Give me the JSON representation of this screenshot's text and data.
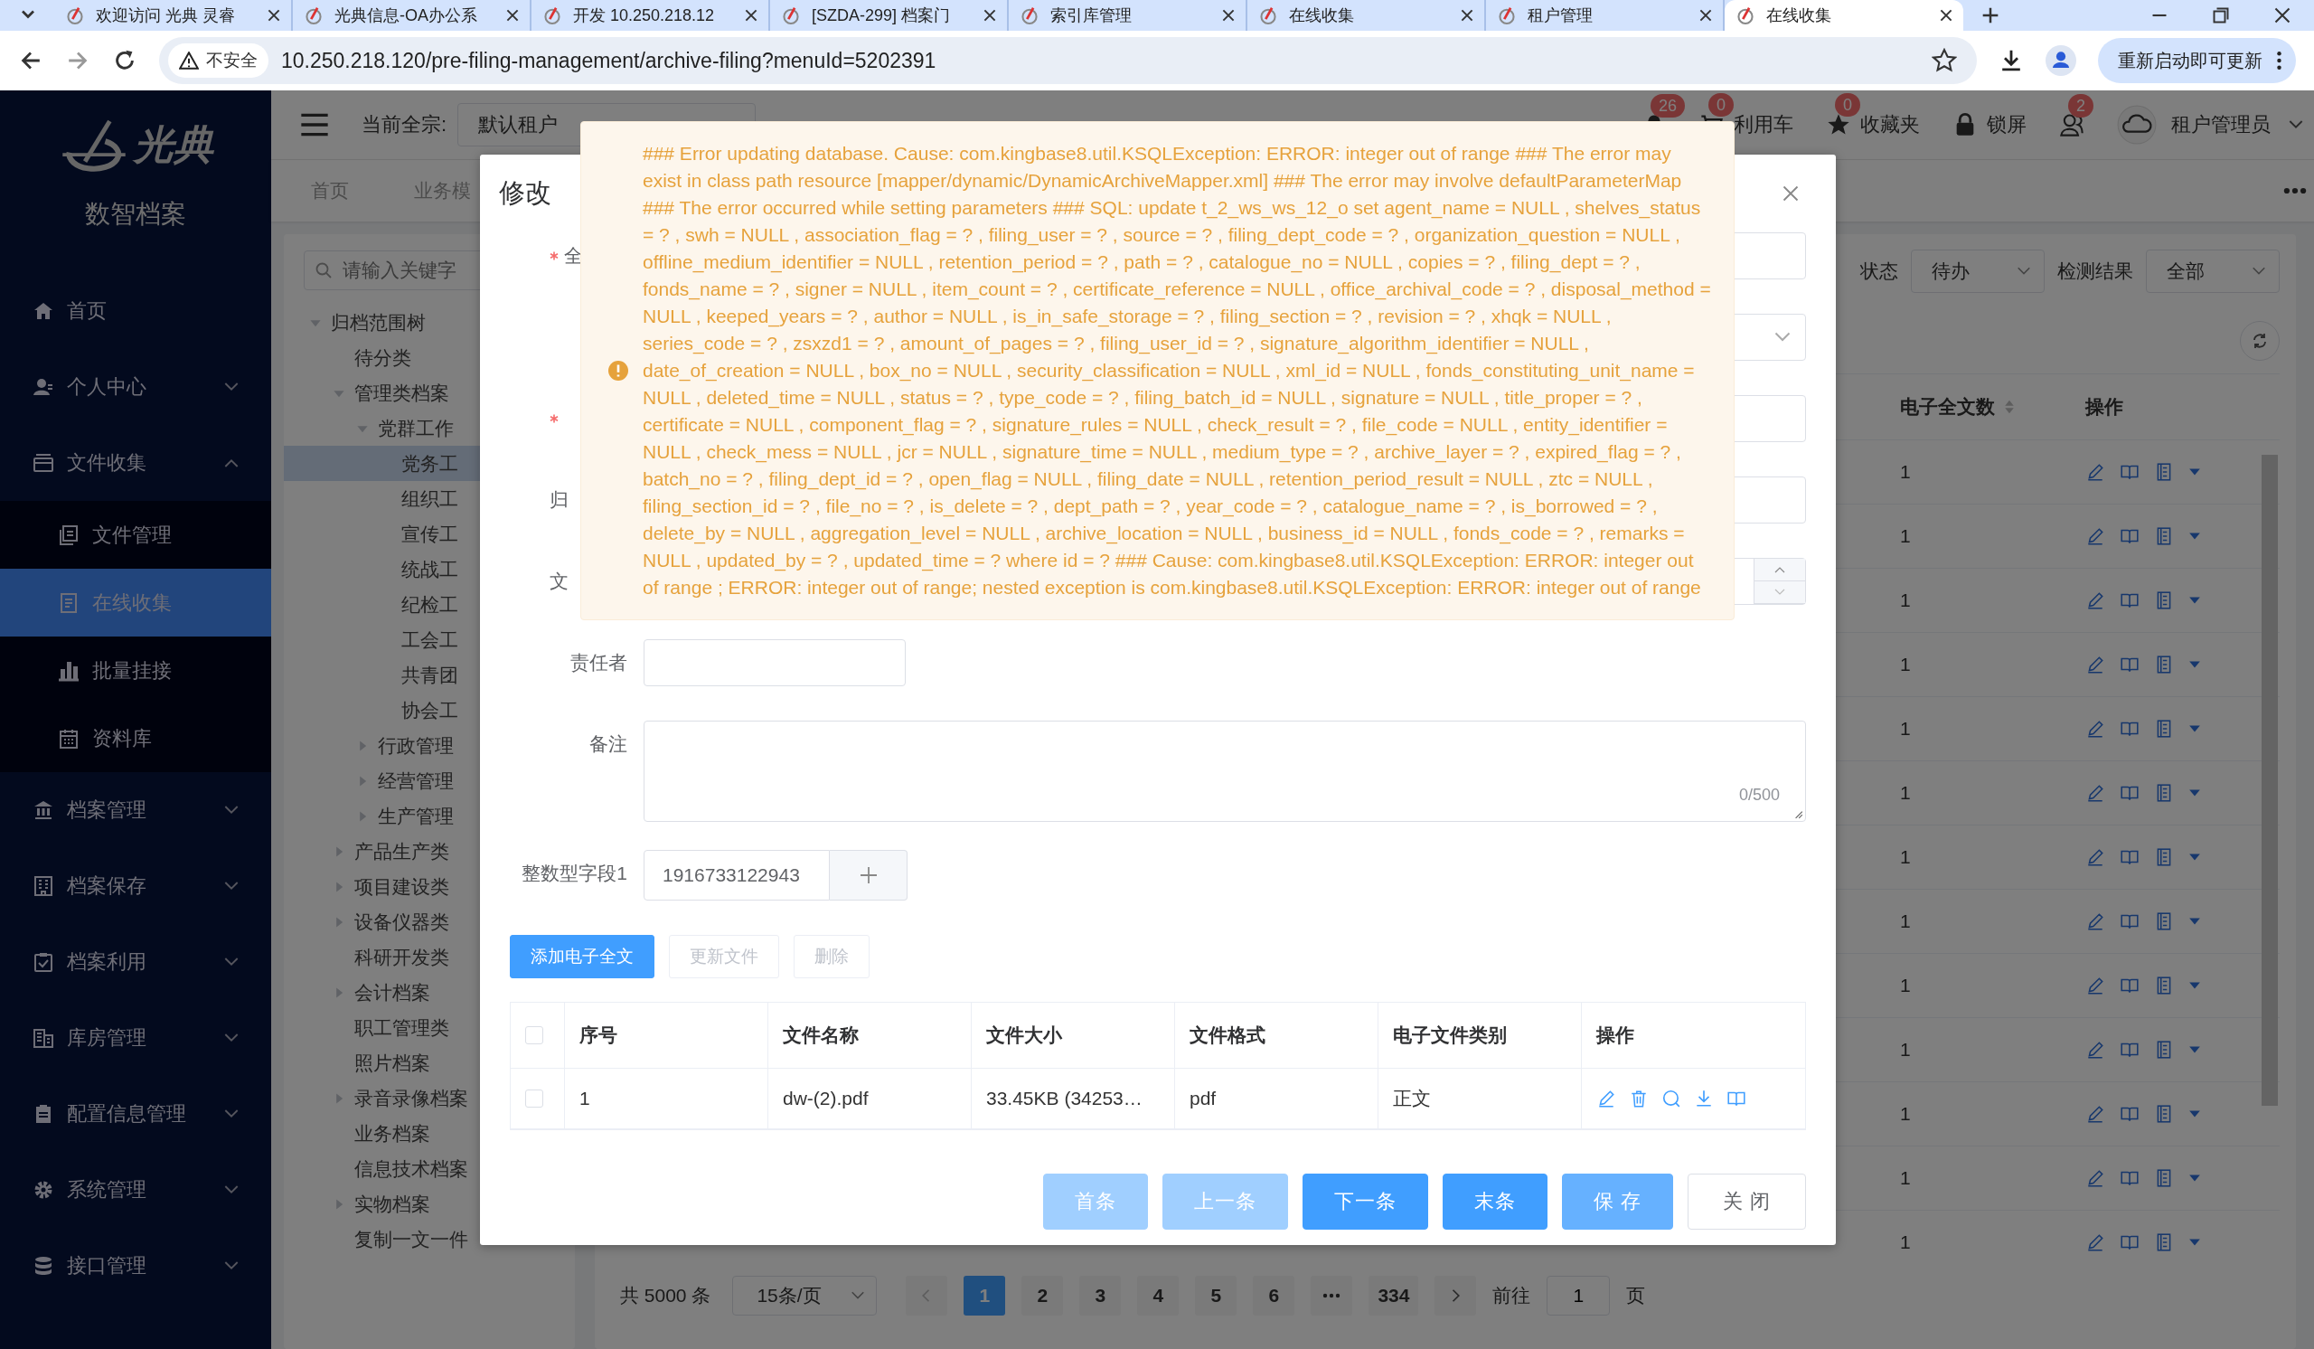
{
  "browser": {
    "tabs": [
      {
        "title": "欢迎访问 光典 灵睿",
        "selected": false
      },
      {
        "title": "光典信息-OA办公系",
        "selected": false
      },
      {
        "title": "开发 10.250.218.12",
        "selected": false
      },
      {
        "title": "[SZDA-299] 档案门",
        "selected": false
      },
      {
        "title": "索引库管理",
        "selected": false
      },
      {
        "title": "在线收集",
        "selected": false
      },
      {
        "title": "租户管理",
        "selected": false
      },
      {
        "title": "在线收集",
        "selected": true
      }
    ],
    "security_label": "不安全",
    "url": "10.250.218.120/pre-filing-management/archive-filing?menuId=5202391",
    "update_button": "重新启动即可更新"
  },
  "sidebar": {
    "brand": "光典",
    "subtitle": "数智档案",
    "menu": [
      {
        "label": "首页",
        "kind": "link"
      },
      {
        "label": "个人中心",
        "kind": "group",
        "expanded": false
      },
      {
        "label": "文件收集",
        "kind": "group",
        "expanded": true,
        "children": [
          {
            "label": "文件管理",
            "selected": false
          },
          {
            "label": "在线收集",
            "selected": true
          },
          {
            "label": "批量挂接",
            "selected": false
          },
          {
            "label": "资料库",
            "selected": false
          }
        ]
      },
      {
        "label": "档案管理",
        "kind": "group",
        "expanded": false
      },
      {
        "label": "档案保存",
        "kind": "group",
        "expanded": false
      },
      {
        "label": "档案利用",
        "kind": "group",
        "expanded": false
      },
      {
        "label": "库房管理",
        "kind": "group",
        "expanded": false
      },
      {
        "label": "配置信息管理",
        "kind": "group",
        "expanded": false
      },
      {
        "label": "系统管理",
        "kind": "group",
        "expanded": false
      },
      {
        "label": "接口管理",
        "kind": "group",
        "expanded": false
      }
    ]
  },
  "header": {
    "fonds_label": "当前全宗:",
    "fonds_value": "默认租户",
    "items": [
      {
        "badge": "26"
      },
      {
        "badge": "0",
        "label": "利用车"
      },
      {
        "badge": "0",
        "label": "收藏夹"
      },
      {
        "label": "锁屏"
      },
      {
        "badge": "2"
      }
    ],
    "user": "租户管理员"
  },
  "tags": [
    {
      "label": "首页",
      "selected": false
    },
    {
      "label": "业务模",
      "selected": false
    }
  ],
  "tree": {
    "search_placeholder": "请输入关键字",
    "nodes": [
      {
        "label": "归档范围树",
        "selected": false,
        "expanded": true,
        "children": [
          {
            "label": "待分类",
            "selected": false
          },
          {
            "label": "管理类档案",
            "selected": false,
            "expanded": true,
            "children": [
              {
                "label": "党群工作",
                "selected": false,
                "expanded": true,
                "children": [
                  {
                    "label": "党务工",
                    "selected": true
                  },
                  {
                    "label": "组织工",
                    "selected": false
                  },
                  {
                    "label": "宣传工",
                    "selected": false
                  },
                  {
                    "label": "统战工",
                    "selected": false
                  },
                  {
                    "label": "纪检工",
                    "selected": false
                  },
                  {
                    "label": "工会工",
                    "selected": false
                  },
                  {
                    "label": "共青团",
                    "selected": false
                  },
                  {
                    "label": "协会工",
                    "selected": false
                  }
                ]
              },
              {
                "label": "行政管理",
                "selected": false,
                "expanded": false
              },
              {
                "label": "经营管理",
                "selected": false,
                "expanded": false
              },
              {
                "label": "生产管理",
                "selected": false,
                "expanded": false
              }
            ]
          },
          {
            "label": "产品生产类",
            "selected": false,
            "expanded": false
          },
          {
            "label": "项目建设类",
            "selected": false,
            "expanded": false
          },
          {
            "label": "设备仪器类",
            "selected": false,
            "expanded": false
          },
          {
            "label": "科研开发类",
            "selected": false
          },
          {
            "label": "会计档案",
            "selected": false,
            "expanded": false
          },
          {
            "label": "职工管理类",
            "selected": false
          },
          {
            "label": "照片档案",
            "selected": false
          },
          {
            "label": "录音录像档案",
            "selected": false,
            "expanded": false
          },
          {
            "label": "业务档案",
            "selected": false
          },
          {
            "label": "信息技术档案",
            "selected": false
          },
          {
            "label": "实物档案",
            "selected": false,
            "expanded": false
          },
          {
            "label": "复制一文一件",
            "selected": false
          }
        ]
      }
    ]
  },
  "filters": [
    {
      "label": "状态",
      "value": "待办"
    },
    {
      "label": "检测结果",
      "value": "全部"
    }
  ],
  "table": {
    "columns": [
      "电子全文数",
      "操作"
    ],
    "rows": [
      {
        "count": "1"
      },
      {
        "count": "1"
      },
      {
        "count": "1"
      },
      {
        "count": "1"
      },
      {
        "count": "1"
      },
      {
        "count": "1"
      },
      {
        "count": "1"
      },
      {
        "count": "1"
      },
      {
        "count": "1"
      },
      {
        "count": "1"
      },
      {
        "count": "1"
      },
      {
        "count": "1"
      },
      {
        "count": "1"
      }
    ]
  },
  "pagination": {
    "total": "共 5000 条",
    "page_size": "15条/页",
    "pages": [
      {
        "label": "1",
        "selected": true
      },
      {
        "label": "2",
        "selected": false
      },
      {
        "label": "3",
        "selected": false
      },
      {
        "label": "4",
        "selected": false
      },
      {
        "label": "5",
        "selected": false
      },
      {
        "label": "6",
        "selected": false
      },
      {
        "kind": "ellipsis"
      },
      {
        "label": "334",
        "selected": false
      }
    ],
    "goto_label": "前往",
    "goto_value": "1",
    "page_unit": "页"
  },
  "modal": {
    "title": "修改",
    "covered_fields": [
      {
        "label": "全",
        "required": true,
        "kind": "input"
      },
      {
        "required": false,
        "kind": "select"
      },
      {
        "required": true,
        "kind": "input"
      },
      {
        "label": "归",
        "required": false,
        "kind": "input"
      },
      {
        "label": "文",
        "required": false,
        "kind": "number"
      }
    ],
    "responsible_label": "责任者",
    "remarks_label": "备注",
    "remarks_counter": "0/500",
    "int_label": "整数型字段1",
    "int_value": "1916733122943",
    "file_buttons": [
      {
        "label": "添加电子全文",
        "disabled": false
      },
      {
        "label": "更新文件",
        "disabled": true
      },
      {
        "label": "删除",
        "disabled": true
      }
    ],
    "file_table": {
      "all_checked": false,
      "columns": [
        "序号",
        "文件名称",
        "文件大小",
        "文件格式",
        "电子文件类别",
        "操作"
      ],
      "rows": [
        {
          "checked": false,
          "cells": [
            "1",
            "dw-(2).pdf",
            "33.45KB (34253…",
            "pdf",
            "正文"
          ]
        }
      ]
    },
    "footer_buttons": [
      {
        "label": "首条",
        "kind": "primary",
        "disabled": true,
        "hover": false
      },
      {
        "label": "上一条",
        "kind": "primary",
        "disabled": true,
        "hover": false
      },
      {
        "label": "下一条",
        "kind": "primary",
        "disabled": false,
        "hover": false
      },
      {
        "label": "末条",
        "kind": "primary",
        "disabled": false,
        "hover": false
      },
      {
        "label": "保 存",
        "kind": "primary",
        "disabled": false,
        "hover": true
      },
      {
        "label": "关 闭",
        "kind": "default",
        "disabled": false,
        "hover": false
      }
    ]
  },
  "toast": {
    "message": "### Error updating database. Cause: com.kingbase8.util.KSQLException: ERROR: integer out of range ### The error may exist in class path resource [mapper/dynamic/DynamicArchiveMapper.xml] ### The error may involve defaultParameterMap ### The error occurred while setting parameters ### SQL: update t_2_ws_ws_12_o set agent_name = NULL , shelves_status = ? , swh = NULL , association_flag = ? , filing_user = ? , source = ? , filing_dept_code = ? , organization_question = NULL , offline_medium_identifier = NULL , retention_period = ? , path = ? , catalogue_no = NULL , copies = ? , filing_dept = ? , fonds_name = ? , signer = NULL , item_count = ? , certificate_reference = NULL , office_archival_code = ? , disposal_method = NULL , keeped_years = ? , author = NULL , is_in_safe_storage = ? , filing_section = ? , revision = ? , xhqk = NULL , series_code = ? , zsxzd1 = ? , amount_of_pages = ? , filing_user_id = ? , signature_algorithm_identifier = NULL , date_of_creation = NULL , box_no = NULL , security_classification = NULL , xml_id = NULL , fonds_constituting_unit_name = NULL , deleted_time = NULL , status = ? , type_code = ? , filing_batch_id = NULL , signature = NULL , title_proper = ? , certificate = NULL , component_flag = ? , signature_rules = NULL , check_result = ? , file_code = NULL , entity_identifier = NULL , check_mess = NULL , jcr = NULL , signature_time = NULL , medium_type = ? , archive_layer = ? , expired_flag = ? , batch_no = ? , filing_dept_id = ? , open_flag = NULL , filing_date = NULL , retention_period_result = NULL , ztc = NULL , filing_section_id = ? , file_no = ? , is_delete = ? , dept_path = ? , year_code = ? , catalogue_name = ? , is_borrowed = ? , delete_by = NULL , aggregation_level = NULL , archive_location = NULL , business_id = NULL , fonds_code = ? , remarks = NULL , updated_by = ? , updated_time = ? where id = ? ### Cause: com.kingbase8.util.KSQLException: ERROR: integer out of range ; ERROR: integer out of range; nested exception is com.kingbase8.util.KSQLException: ERROR: integer out of range"
  }
}
